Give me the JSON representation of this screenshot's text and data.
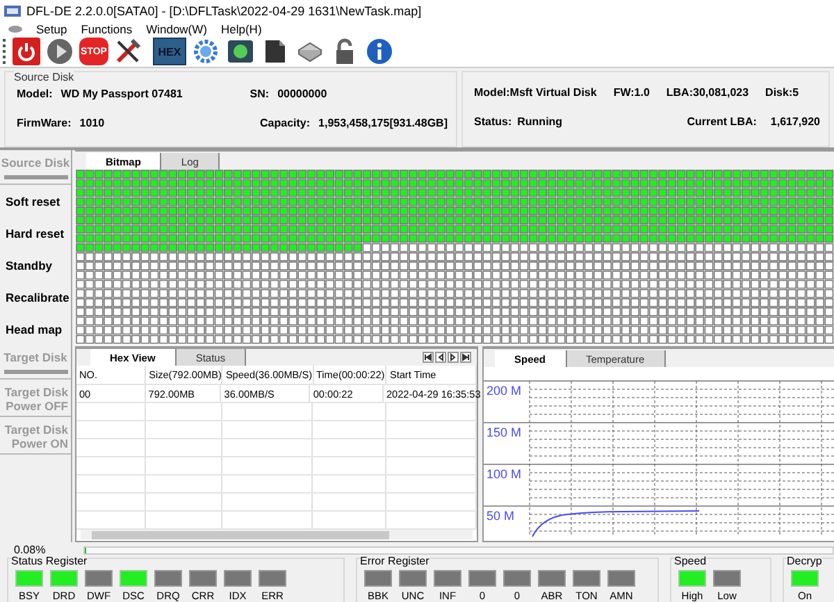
{
  "window": {
    "title": "DFL-DE 2.2.0.0[SATA0] - [D:\\DFLTask\\2022-04-29 1631\\NewTask.map]"
  },
  "menu": [
    "Setup",
    "Functions",
    "Window(W)",
    "Help(H)"
  ],
  "toolbar": [
    {
      "kind": "power"
    },
    {
      "kind": "play"
    },
    {
      "kind": "stop",
      "label": "STOP"
    },
    {
      "kind": "tools"
    },
    {
      "kind": "hex",
      "label": "HEX"
    },
    {
      "kind": "gear"
    },
    {
      "kind": "refresh"
    },
    {
      "kind": "folder"
    },
    {
      "kind": "drive"
    },
    {
      "kind": "lock"
    },
    {
      "kind": "info"
    }
  ],
  "source_disk": {
    "title": "Source Disk",
    "model_label": "Model:",
    "model": "WD My Passport 07481",
    "sn_label": "SN:",
    "sn": "00000000",
    "firmware_label": "FirmWare:",
    "firmware": "1010",
    "capacity_label": "Capacity:",
    "capacity": "1,953,458,175[931.48GB]"
  },
  "target_info": {
    "model": "Model:Msft   Virtual Disk",
    "fw": "FW:1.0",
    "lba": "LBA:30,081,023",
    "disk": "Disk:5",
    "status_label": "Status:",
    "status": "Running",
    "current_lba_label": "Current LBA:",
    "current_lba": "1,617,920"
  },
  "sidebar": [
    {
      "label": "Source Disk",
      "kind": "header",
      "disabled": true
    },
    {
      "label": "Soft reset",
      "kind": "action",
      "disabled": false
    },
    {
      "label": "Hard reset",
      "kind": "action",
      "disabled": false
    },
    {
      "label": "Standby",
      "kind": "action",
      "disabled": false
    },
    {
      "label": "Recalibrate",
      "kind": "action",
      "disabled": false
    },
    {
      "label": "Head map",
      "kind": "action",
      "disabled": false
    },
    {
      "label": "Target Disk",
      "kind": "header",
      "disabled": true
    },
    {
      "label": "Target Disk\nPower OFF",
      "kind": "action",
      "disabled": true
    },
    {
      "label": "Target Disk\nPower ON",
      "kind": "action",
      "disabled": true
    }
  ],
  "map_tabs": [
    {
      "label": "Bitmap",
      "selected": true
    },
    {
      "label": "Log",
      "selected": false
    }
  ],
  "bitmap": {
    "rows": [
      {
        "kind": "full"
      },
      {
        "kind": "full"
      },
      {
        "kind": "full"
      },
      {
        "kind": "full"
      },
      {
        "kind": "full"
      },
      {
        "kind": "full"
      },
      {
        "kind": "full"
      },
      {
        "kind": "full"
      },
      {
        "kind": "partial",
        "level": 0.38
      },
      {
        "kind": "empty"
      },
      {
        "kind": "empty"
      },
      {
        "kind": "empty"
      },
      {
        "kind": "empty"
      },
      {
        "kind": "empty"
      },
      {
        "kind": "empty"
      },
      {
        "kind": "empty"
      },
      {
        "kind": "empty"
      },
      {
        "kind": "empty"
      },
      {
        "kind": "empty"
      }
    ]
  },
  "table_tabs": [
    {
      "label": "Hex View",
      "selected": true
    },
    {
      "label": "Status",
      "selected": false
    }
  ],
  "table": {
    "columns": [
      "NO.",
      "Size(792.00MB)",
      "Speed(36.00MB/S)",
      "Time(00:00:22)",
      "Start Time"
    ],
    "rows": [
      [
        "00",
        "792.00MB",
        "36.00MB/S",
        "00:00:22",
        "2022-04-29 16:35:53"
      ]
    ]
  },
  "chart_tabs": [
    {
      "label": "Speed",
      "selected": true
    },
    {
      "label": "Temperature",
      "selected": false
    }
  ],
  "chart_labels": [
    "200 M",
    "150 M",
    "100 M",
    "50 M"
  ],
  "progress": {
    "label": "0.08%",
    "level": 0.0008
  },
  "registers": [
    {
      "title": "Status Register",
      "leds": [
        {
          "label": "BSY",
          "on": true
        },
        {
          "label": "DRD",
          "on": true
        },
        {
          "label": "DWF",
          "on": false
        },
        {
          "label": "DSC",
          "on": true
        },
        {
          "label": "DRQ",
          "on": false
        },
        {
          "label": "CRR",
          "on": false
        },
        {
          "label": "IDX",
          "on": false
        },
        {
          "label": "ERR",
          "on": false
        }
      ]
    },
    {
      "title": "Error Register",
      "leds": [
        {
          "label": "BBK",
          "on": false
        },
        {
          "label": "UNC",
          "on": false
        },
        {
          "label": "INF",
          "on": false
        },
        {
          "label": "0",
          "on": false
        },
        {
          "label": "0",
          "on": false
        },
        {
          "label": "ABR",
          "on": false
        },
        {
          "label": "TON",
          "on": false
        },
        {
          "label": "AMN",
          "on": false
        }
      ]
    },
    {
      "title": "Speed",
      "leds": [
        {
          "label": "High",
          "on": true
        },
        {
          "label": "Low",
          "on": false
        }
      ]
    },
    {
      "title": "Decryp",
      "leds": [
        {
          "label": "On",
          "on": true
        }
      ]
    }
  ]
}
